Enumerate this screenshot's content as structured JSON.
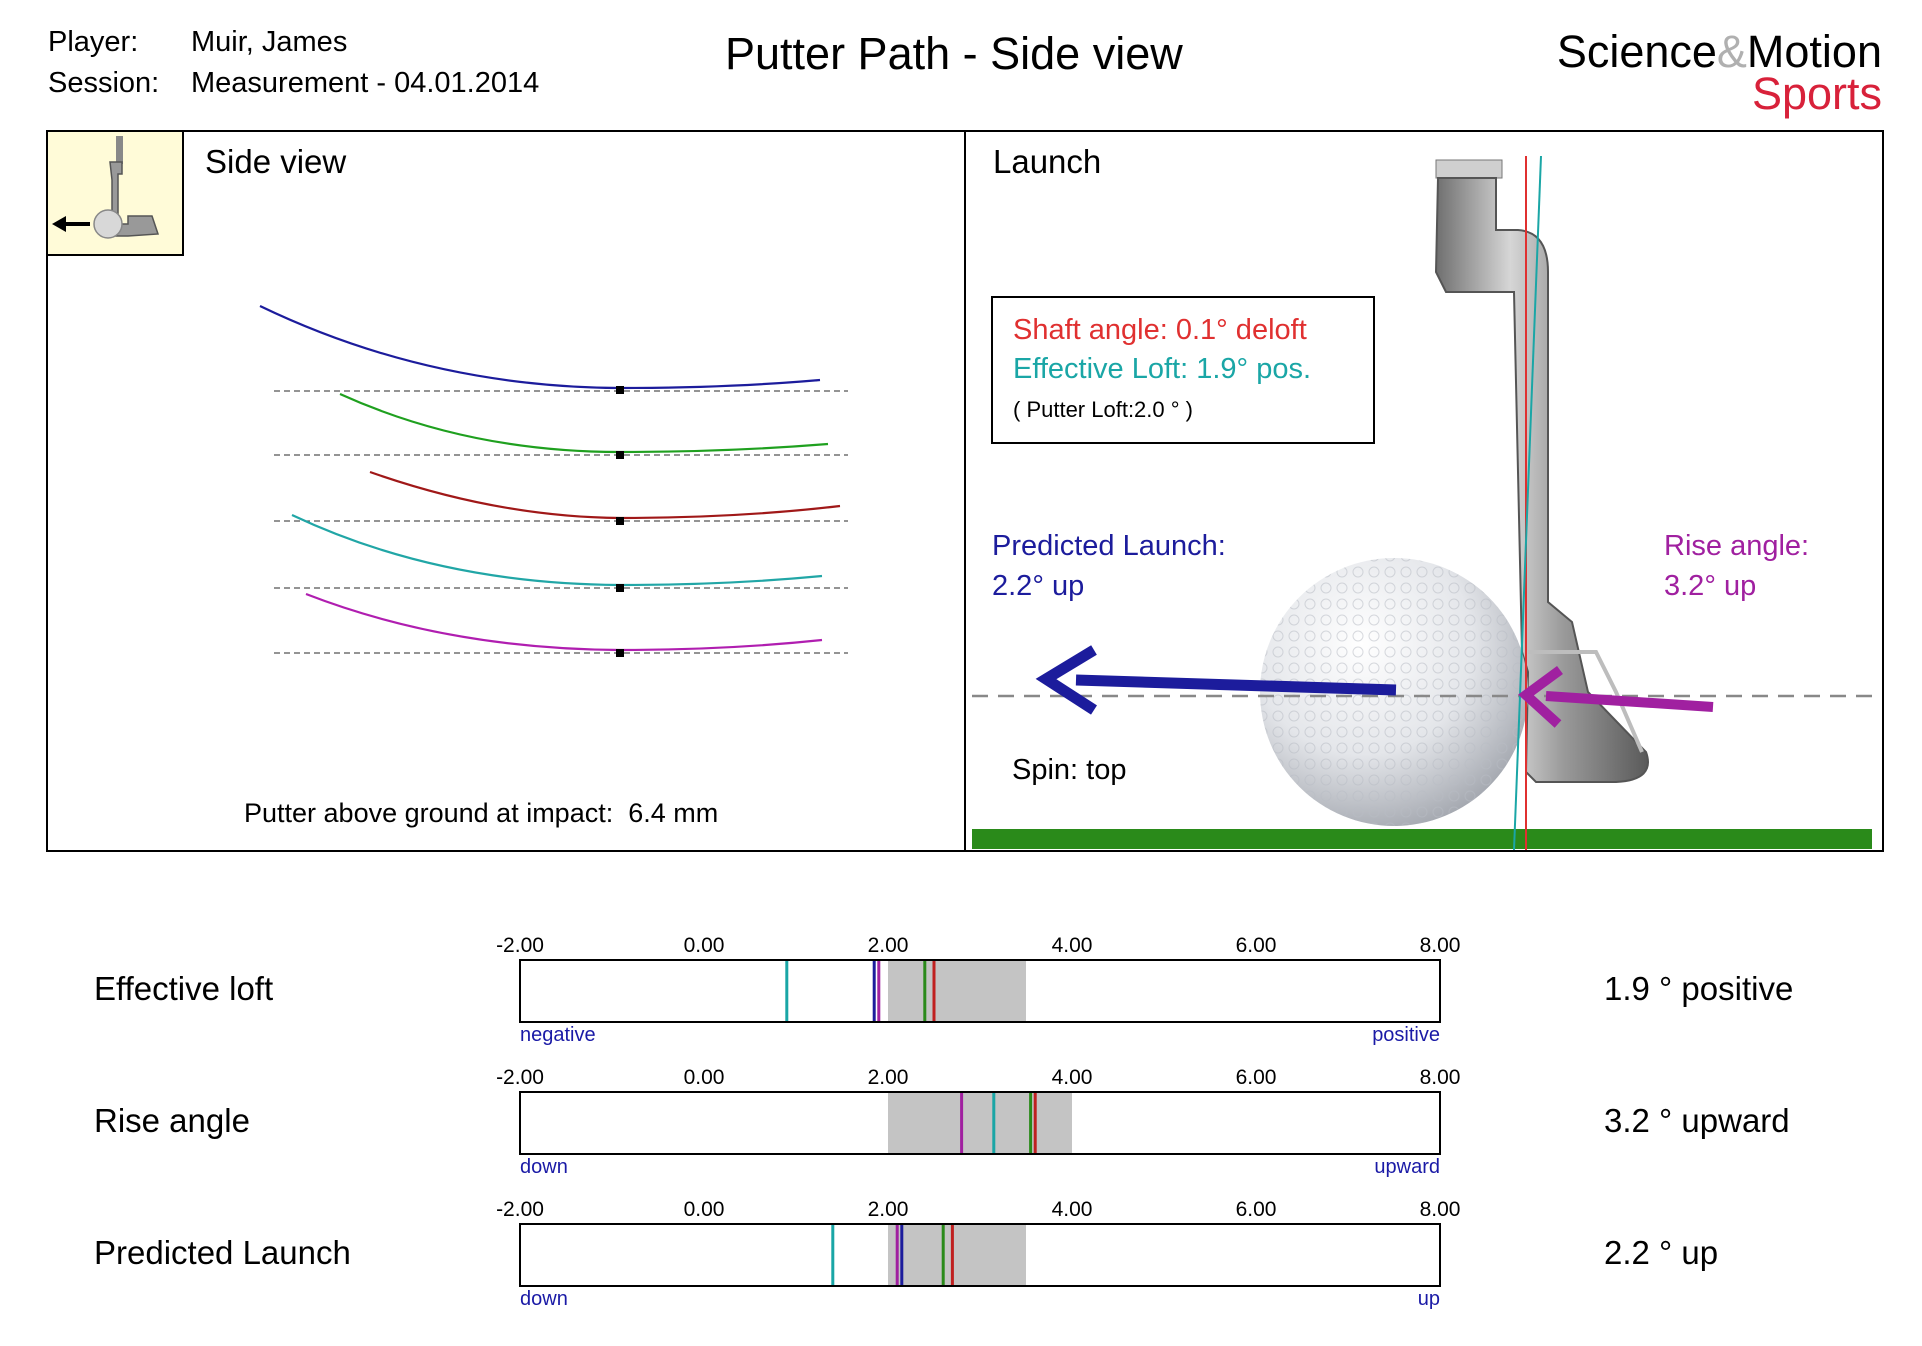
{
  "header": {
    "player_label": "Player:",
    "player_value": "Muir, James",
    "session_label": "Session:",
    "session_value": "Measurement - 04.01.2014",
    "title": "Putter Path - Side view",
    "brand_science": "Science",
    "brand_amp": "&",
    "brand_motion": "Motion",
    "brand_sports": "Sports"
  },
  "side_view": {
    "title": "Side view",
    "footer_label": "Putter above ground at impact:",
    "footer_value": "6.4 mm",
    "stroke_colors": [
      "#1c1c9c",
      "#1fa01f",
      "#a01818",
      "#21a6a6",
      "#b01eb0"
    ]
  },
  "launch": {
    "title": "Launch",
    "shaft_angle": "Shaft angle: 0.1° deloft",
    "effective_loft": "Effective Loft: 1.9° pos.",
    "putter_loft": "( Putter Loft:2.0 ° )",
    "predicted_label": "Predicted Launch:",
    "predicted_value": "2.2° up",
    "rise_label": "Rise angle:",
    "rise_value": "3.2° up",
    "spin": "Spin: top",
    "colors": {
      "shaft": "#e03030",
      "loft": "#1aa6a6",
      "predicted": "#1c1c9c",
      "rise": "#a020a0",
      "ground": "#2a8a1a"
    }
  },
  "chart_data": [
    {
      "type": "range-bar",
      "title": "Effective loft",
      "xlim": [
        -2,
        8
      ],
      "ticks": [
        "-2.00",
        "0.00",
        "2.00",
        "4.00",
        "6.00",
        "8.00"
      ],
      "range": [
        2.0,
        3.5
      ],
      "markers": [
        {
          "value": 0.9,
          "color": "#1aa6a6"
        },
        {
          "value": 1.85,
          "color": "#1c1c9c"
        },
        {
          "value": 1.9,
          "color": "#a020a0"
        },
        {
          "value": 2.4,
          "color": "#2a8a1a"
        },
        {
          "value": 2.5,
          "color": "#c02020"
        }
      ],
      "left_label": "negative",
      "right_label": "positive",
      "value_text": "1.9 ° positive"
    },
    {
      "type": "range-bar",
      "title": "Rise angle",
      "xlim": [
        -2,
        8
      ],
      "ticks": [
        "-2.00",
        "0.00",
        "2.00",
        "4.00",
        "6.00",
        "8.00"
      ],
      "range": [
        2.0,
        4.0
      ],
      "markers": [
        {
          "value": 2.8,
          "color": "#a020a0"
        },
        {
          "value": 3.15,
          "color": "#1aa6a6"
        },
        {
          "value": 3.55,
          "color": "#2a8a1a"
        },
        {
          "value": 3.6,
          "color": "#c02020"
        }
      ],
      "left_label": "down",
      "right_label": "upward",
      "value_text": "3.2 ° upward"
    },
    {
      "type": "range-bar",
      "title": "Predicted Launch",
      "xlim": [
        -2,
        8
      ],
      "ticks": [
        "-2.00",
        "0.00",
        "2.00",
        "4.00",
        "6.00",
        "8.00"
      ],
      "range": [
        2.0,
        3.5
      ],
      "markers": [
        {
          "value": 1.4,
          "color": "#1aa6a6"
        },
        {
          "value": 2.1,
          "color": "#a020a0"
        },
        {
          "value": 2.15,
          "color": "#1c1c9c"
        },
        {
          "value": 2.6,
          "color": "#2a8a1a"
        },
        {
          "value": 2.7,
          "color": "#c02020"
        }
      ],
      "left_label": "down",
      "right_label": "up",
      "value_text": "2.2 ° up"
    }
  ]
}
